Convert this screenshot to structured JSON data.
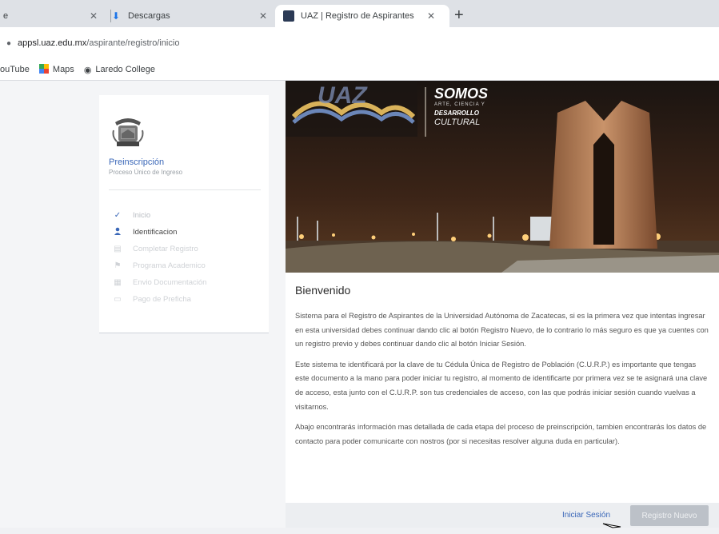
{
  "browser": {
    "tabs": [
      {
        "label": "e"
      },
      {
        "label": "Descargas"
      },
      {
        "label": "UAZ | Registro de Aspirantes"
      }
    ],
    "new_tab": "+",
    "address": {
      "host": "appsl.uaz.edu.mx",
      "path": "/aspirante/registro/inicio"
    },
    "bookmarks": [
      {
        "label": "ouTube"
      },
      {
        "label": "Maps"
      },
      {
        "label": "Laredo College"
      }
    ]
  },
  "sidebar": {
    "title": "Preinscripción",
    "subtitle": "Proceso Único de Ingreso",
    "steps": [
      {
        "label": "Inicio",
        "icon": "check-icon",
        "state": "done"
      },
      {
        "label": "Identificacion",
        "icon": "person-icon",
        "state": "active"
      },
      {
        "label": "Completar Registro",
        "icon": "id-card-icon",
        "state": "disabled"
      },
      {
        "label": "Programa Academico",
        "icon": "school-icon",
        "state": "disabled"
      },
      {
        "label": "Envio Documentación",
        "icon": "document-icon",
        "state": "disabled"
      },
      {
        "label": "Pago de Preficha",
        "icon": "payment-icon",
        "state": "disabled"
      }
    ]
  },
  "hero": {
    "logo_text": "UAZ",
    "slogan_main": "SOMOS",
    "slogan_line2": "ARTE, CIENCIA Y",
    "slogan_line3": "DESARROLLO",
    "slogan_line4": "CULTURAL"
  },
  "main": {
    "heading": "Bienvenido",
    "paragraphs": [
      "Sistema para el Registro de Aspirantes de la Universidad Autónoma de Zacatecas, si es la primera vez que intentas ingresar en esta universidad debes continuar dando clic al botón Registro Nuevo, de lo contrario lo más seguro es que ya cuentes con un registro previo y debes continuar dando clic al botón Iniciar Sesión.",
      "Este sistema te identificará por la clave de tu Cédula Única de Registro de Población (C.U.R.P.) es importante que tengas este documento a la mano para poder iniciar tu registro, al momento de identificarte por primera vez se te asignará una clave de acceso, esta junto con el C.U.R.P. son tus credenciales de acceso, con las que podrás iniciar sesión cuando vuelvas a visitarnos.",
      "Abajo encontrarás información mas detallada de cada etapa del proceso de preinscripción, tambien encontrarás los datos de contacto para poder comunicarte con nostros (por si necesitas resolver alguna duda en particular)."
    ],
    "login_label": "Iniciar Sesión",
    "register_label": "Registro Nuevo"
  },
  "colors": {
    "accent": "#3a67b8",
    "disabled_button": "#bcc1c8"
  }
}
